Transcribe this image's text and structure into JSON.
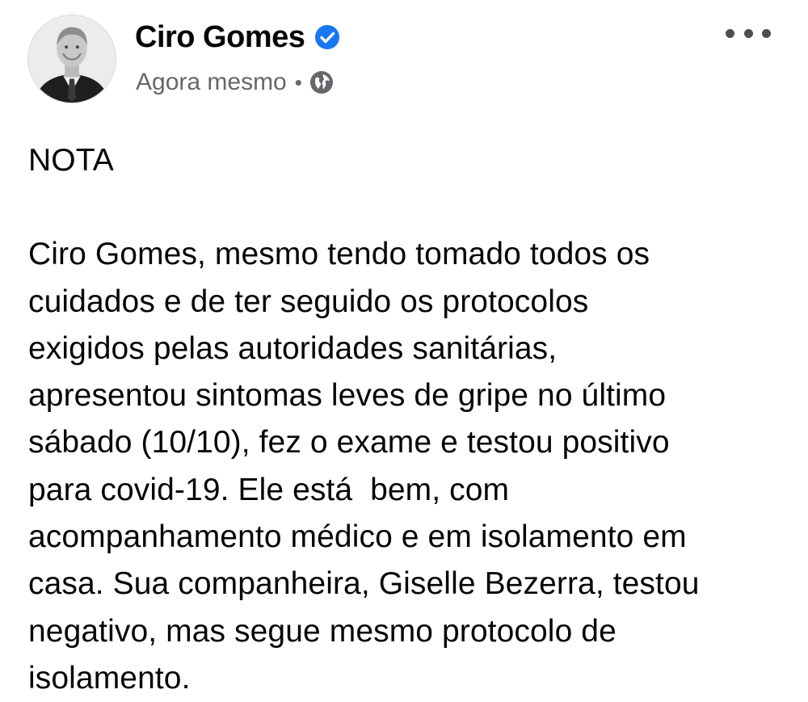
{
  "post": {
    "author": {
      "name": "Ciro Gomes",
      "verified": true,
      "avatar_icon": "person-portrait-icon"
    },
    "meta": {
      "time": "Agora mesmo",
      "separator": "•",
      "audience_icon": "globe-icon"
    },
    "more_icon": "more-options-icon",
    "heading": "NOTA",
    "body_lines": [
      "Ciro Gomes, mesmo tendo tomado todos os",
      "cuidados e de ter seguido os protocolos",
      "exigidos pelas autoridades sanitárias,",
      "apresentou sintomas leves de gripe no último",
      "sábado (10/10), fez o exame e testou positivo",
      "para covid-19. Ele está  bem, com",
      "acompanhamento médico e em isolamento em",
      "casa. Sua companheira, Giselle Bezerra, testou",
      "negativo, mas segue mesmo protocolo de",
      "isolamento."
    ]
  },
  "colors": {
    "verified_badge": "#1877f2",
    "meta_text": "#65676b",
    "body_text": "#050505"
  }
}
